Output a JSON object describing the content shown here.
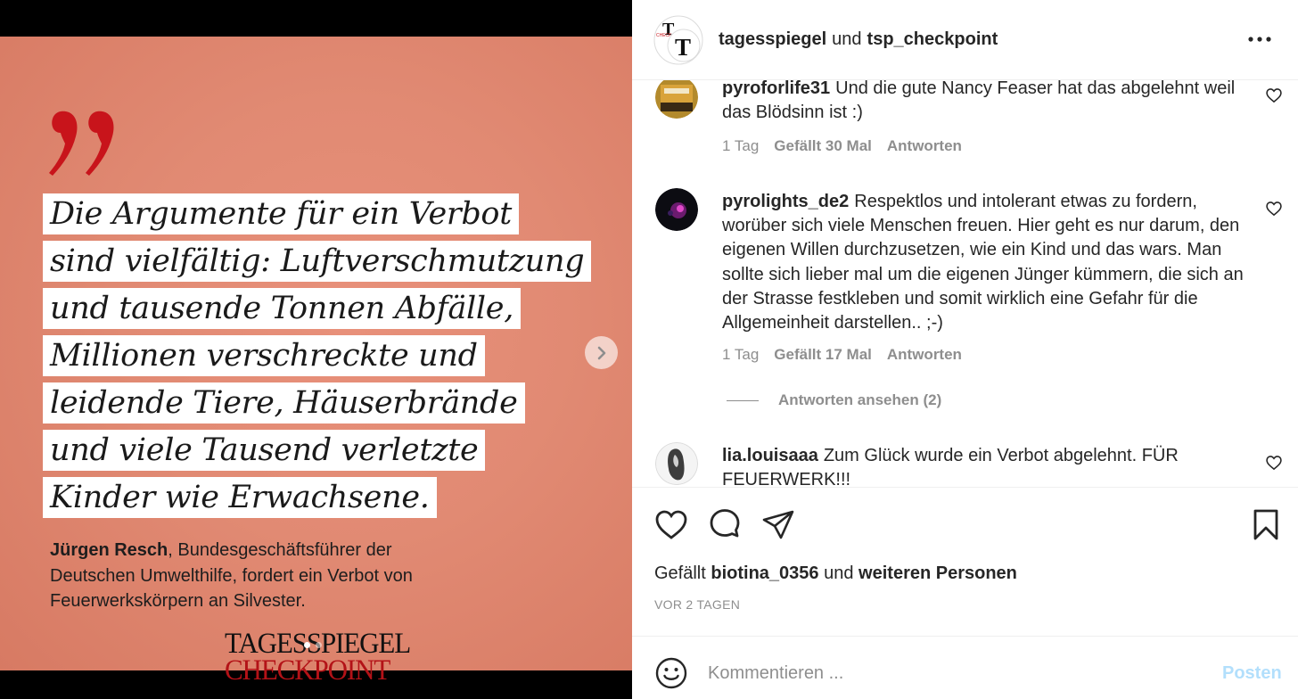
{
  "post": {
    "quote_lines": [
      "Die Argumente für ein Verbot",
      "sind vielfältig: Luftverschmutzung",
      "und tausende Tonnen Abfälle,",
      "Millionen verschreckte und",
      "leidende Tiere, Häuserbrände",
      "und viele Tausend verletzte",
      "Kinder wie Erwachsene."
    ],
    "attribution_name": "Jürgen Resch",
    "attribution_text": ", Bundesgeschäftsführer der Deutschen Umwelthilfe, fordert ein Verbot von Feuerwerkskörpern an Silvester.",
    "brand_line1": "TAGESSPIEGEL",
    "brand_line2": "CHECKPOINT",
    "slide_count": 2,
    "active_slide": 1
  },
  "header": {
    "user1": "tagesspiegel",
    "conjunction": "und",
    "user2": "tsp_checkpoint"
  },
  "comments": [
    {
      "user": "pyroforlife31",
      "text": "Und die gute Nancy Feaser hat das abgelehnt weil das Blödsinn ist :)",
      "time": "1 Tag",
      "likes": "Gefällt 30 Mal",
      "reply": "Antworten"
    },
    {
      "user": "pyrolights_de2",
      "text": "Respektlos und intolerant etwas zu fordern, worüber sich viele Menschen freuen. Hier geht es nur darum, den eigenen Willen durchzusetzen, wie ein Kind und das wars. Man sollte sich lieber mal um die eigenen Jünger kümmern, die sich an der Strasse festkleben und somit wirklich eine Gefahr für die Allgemeinheit darstellen.. ;-)",
      "time": "1 Tag",
      "likes": "Gefällt 17 Mal",
      "reply": "Antworten"
    },
    {
      "user": "lia.louisaaa",
      "text": "Zum Glück wurde ein Verbot abgelehnt. FÜR FEUERWERK!!!",
      "time": "",
      "likes": "",
      "reply": ""
    }
  ],
  "view_replies": "Antworten ansehen (2)",
  "liked_by": {
    "prefix": "Gefällt",
    "user": "biotina_0356",
    "middle": "und",
    "suffix": "weiteren Personen"
  },
  "post_time": "VOR 2 TAGEN",
  "comment_box": {
    "placeholder": "Kommentieren ...",
    "post_label": "Posten"
  },
  "colors": {
    "slide_bg": "#e18a73",
    "brand_red": "#b31217",
    "post_button": "#b2dffc",
    "muted": "#8e8e8e"
  }
}
